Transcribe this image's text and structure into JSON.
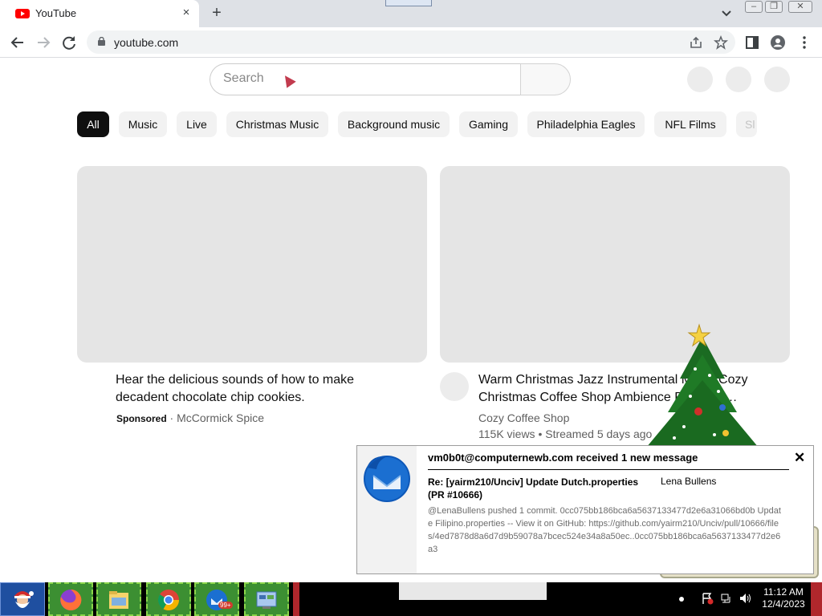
{
  "browser": {
    "tab_title": "YouTube",
    "tab_close_icon": "×",
    "new_tab_icon": "+",
    "tab_menu_icon": "chevron-down",
    "url": "youtube.com",
    "window_controls": {
      "minimize": "–",
      "maximize": "❐",
      "close": "✕"
    }
  },
  "youtube": {
    "search_placeholder": "Search",
    "chips": [
      {
        "label": "All",
        "active": true
      },
      {
        "label": "Music"
      },
      {
        "label": "Live"
      },
      {
        "label": "Christmas Music"
      },
      {
        "label": "Background music"
      },
      {
        "label": "Gaming"
      },
      {
        "label": "Philadelphia Eagles"
      },
      {
        "label": "NFL Films"
      },
      {
        "label": "Sl"
      }
    ],
    "videos": [
      {
        "title_line1": "Hear the delicious sounds of how to make",
        "title_line2": "decadent chocolate chip cookies.",
        "sponsored": "Sponsored",
        "separator": " · ",
        "channel": "McCormick Spice"
      },
      {
        "title_line1": "Warm Christmas Jazz Instrumental Music Cozy",
        "title_line2": "Christmas Coffee Shop Ambience Relaxing…",
        "channel": "Cozy Coffee Shop",
        "stats": "115K views • Streamed 5 days ago"
      }
    ]
  },
  "notification": {
    "header": "vm0b0t@computernewb.com received 1 new message",
    "close": "✕",
    "subject": "Re: [yairm210/Unciv] Update Dutch.properties (PR #10666)",
    "from": "Lena Bullens",
    "body": "@LenaBullens pushed 1 commit. 0cc075bb186bca6a5637133477d2e6a31066bd0b Update Filipino.properties -- View it on GitHub: https://github.com/yairm210/Unciv/pull/10666/files/4ed7878d8a6d7d9b59078a7bcec524e34a8a50ec..0cc075bb186bca6a5637133477d2e6a3"
  },
  "taskbar": {
    "time": "11:12 AM",
    "date": "12/4/2023",
    "badge": "99+"
  },
  "colors": {
    "youtube_red": "#ff0000",
    "chip_active": "#0f0f0f",
    "thunderbird_blue": "#1b6fd1",
    "taskbar_green": "#3c8f32"
  }
}
